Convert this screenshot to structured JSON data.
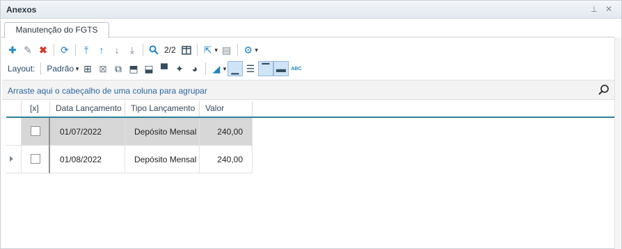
{
  "panel": {
    "title": "Anexos"
  },
  "tabs": [
    {
      "label": "Manutenção do FGTS"
    }
  ],
  "toolbar": {
    "pager": "2/2",
    "layout_label": "Layout:",
    "layout_value": "Padrão"
  },
  "group_bar": {
    "text": "Arraste aqui o cabeçalho de uma coluna para agrupar"
  },
  "grid": {
    "columns": [
      "[x]",
      "Data Lançamento",
      "Tipo Lançamento",
      "Valor"
    ],
    "rows": [
      {
        "checked": false,
        "date": "01/07/2022",
        "tipo": "Depósito Mensal",
        "valor": "240,00",
        "selected": true
      },
      {
        "checked": false,
        "date": "01/08/2022",
        "tipo": "Depósito Mensal",
        "valor": "240,00",
        "selected": false
      }
    ]
  },
  "colors": {
    "accent": "#1f84c6",
    "delete": "#d83a2b",
    "header_line": "#2a7f9c",
    "selected_row": "#d7d7d7"
  },
  "icons": [
    "add-icon",
    "edit-icon",
    "delete-icon",
    "refresh-icon",
    "first-icon",
    "up-icon",
    "down-icon",
    "last-icon",
    "search-icon",
    "columns-icon",
    "export-icon",
    "document-icon",
    "settings-icon",
    "pin-icon",
    "close-icon"
  ]
}
